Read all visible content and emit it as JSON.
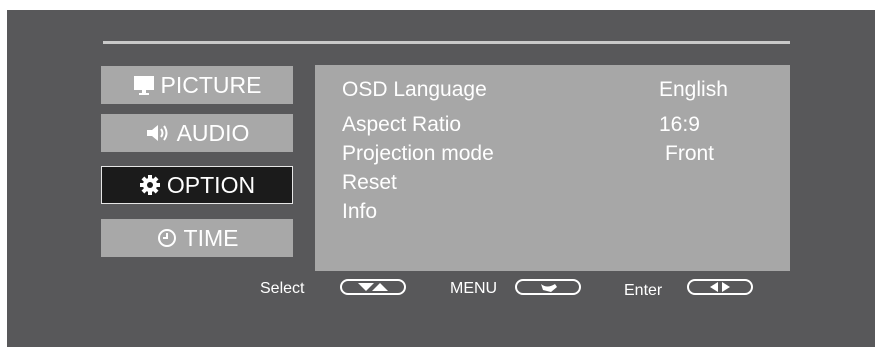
{
  "menu": {
    "items": [
      {
        "label": "PICTURE",
        "icon": "monitor-icon"
      },
      {
        "label": "AUDIO",
        "icon": "speaker-icon"
      },
      {
        "label": "OPTION",
        "icon": "gear-icon",
        "active": true
      },
      {
        "label": "TIME",
        "icon": "clock-icon"
      }
    ]
  },
  "options": [
    {
      "label": "OSD Language",
      "value": "English"
    },
    {
      "label": "Aspect Ratio",
      "value": "16:9"
    },
    {
      "label": "Projection mode",
      "value": "Front"
    },
    {
      "label": "Reset",
      "value": ""
    },
    {
      "label": "Info",
      "value": ""
    }
  ],
  "hints": {
    "select_label": "Select",
    "menu_label": "MENU",
    "enter_label": "Enter"
  },
  "colors": {
    "background": "#58585a",
    "panel": "#a7a7a7",
    "active_item": "#1b1b1b",
    "text": "#ffffff"
  }
}
